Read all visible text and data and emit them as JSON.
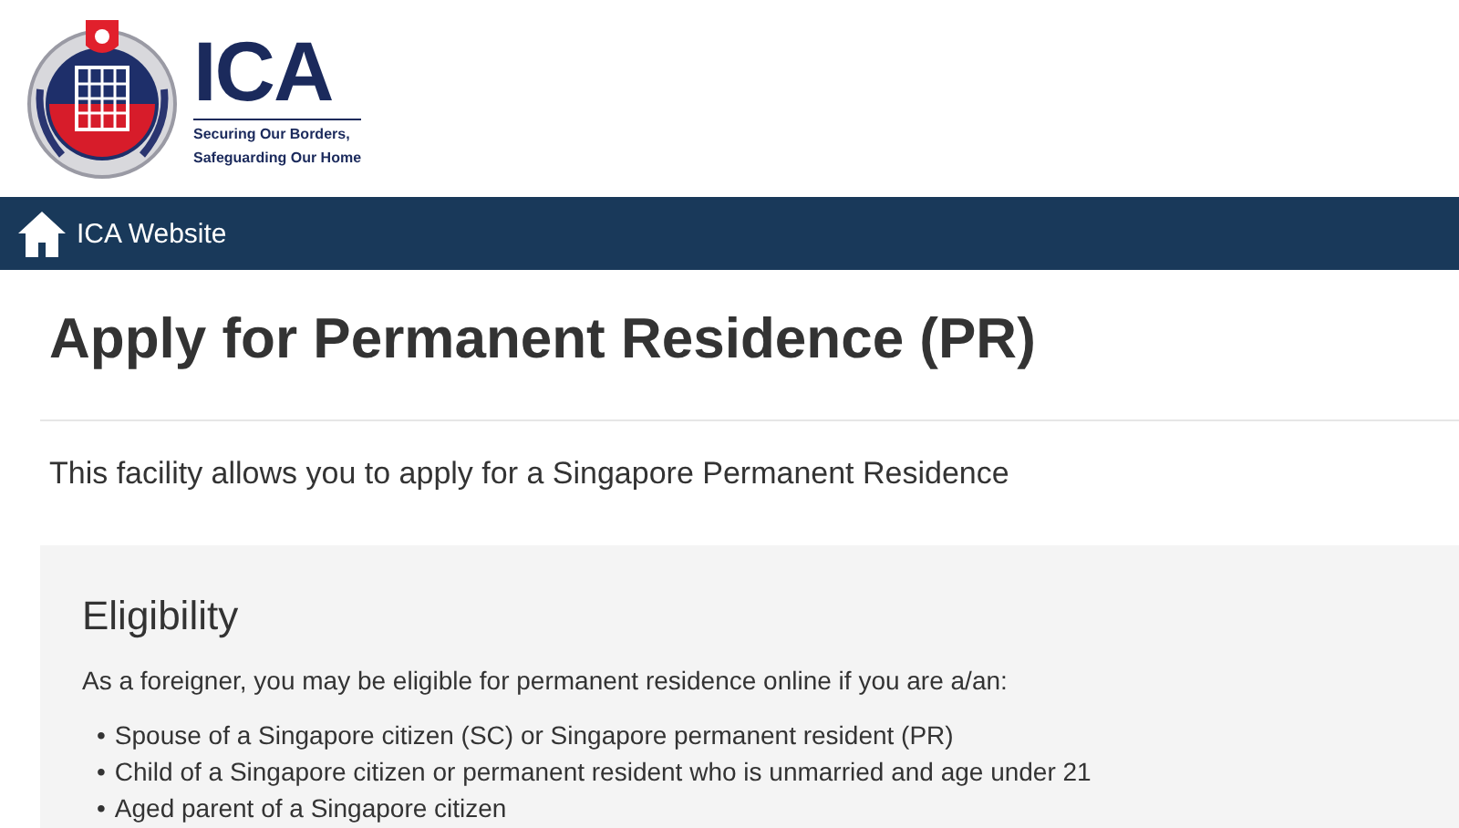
{
  "header": {
    "logo_text": "ICA",
    "tagline": [
      "Securing Our Borders,",
      "Safeguarding Our Home"
    ]
  },
  "nav": {
    "link": "ICA Website"
  },
  "title": "Apply for Permanent Residence (PR)",
  "intro": "This facility allows you to apply for a Singapore Permanent Residence",
  "eligibility": {
    "heading": "Eligibility",
    "lead": "As a foreigner, you may be eligible for permanent residence online if you are a/an:",
    "items": [
      {
        "marker": "•",
        "text": "Spouse of a Singapore citizen (SC) or Singapore permanent resident (PR)"
      },
      {
        "marker": "•",
        "text": "Child of a Singapore citizen or permanent resident who is unmarried and age under 21"
      },
      {
        "marker": "•",
        "text": "Aged parent of a Singapore citizen"
      }
    ]
  }
}
